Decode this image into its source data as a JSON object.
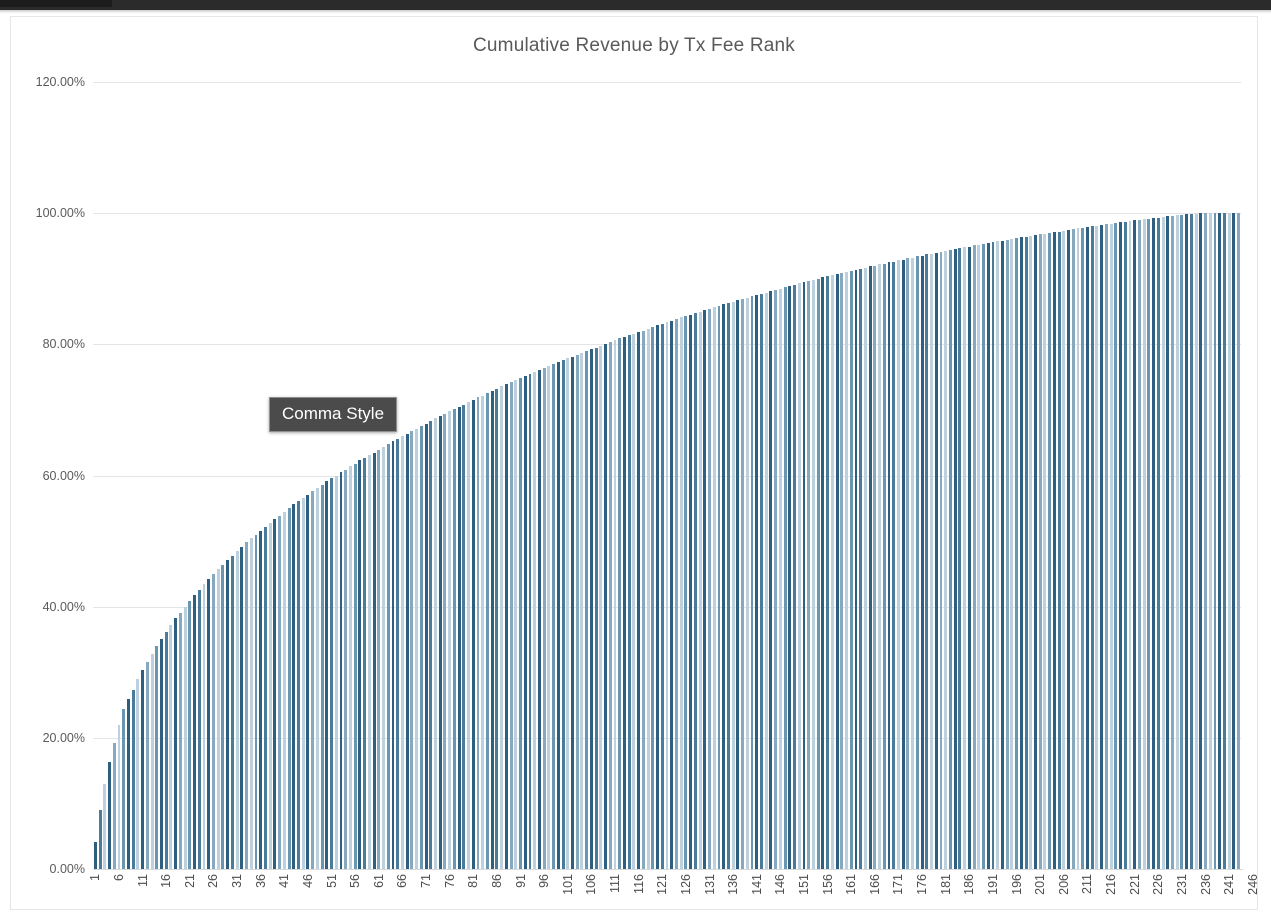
{
  "window": {
    "chrome_color": "#2b2b2b",
    "tab_color": "#1c1c1c"
  },
  "tooltip": {
    "label": "Comma Style",
    "background": "#4b4b4b",
    "text_color": "#ffffff"
  },
  "chart_data": {
    "type": "bar",
    "title": "Cumulative Revenue by Tx Fee Rank",
    "xlabel": "",
    "ylabel": "",
    "ylim": [
      0,
      120
    ],
    "y_unit": "%",
    "grid": true,
    "legend": "none",
    "bar_color": "#2e5f80",
    "bar_color_light": "#bcd0dd",
    "y_ticks": [
      0,
      20,
      40,
      60,
      80,
      100,
      120
    ],
    "y_tick_labels": [
      "0.00%",
      "20.00%",
      "40.00%",
      "60.00%",
      "80.00%",
      "100.00%",
      "120.00%"
    ],
    "x_tick_labels": [
      "1",
      "6",
      "11",
      "16",
      "21",
      "26",
      "31",
      "36",
      "41",
      "46",
      "51",
      "56",
      "61",
      "66",
      "71",
      "76",
      "81",
      "86",
      "91",
      "96",
      "101",
      "106",
      "111",
      "116",
      "121",
      "126",
      "131",
      "136",
      "141",
      "146",
      "151",
      "156",
      "161",
      "166",
      "171",
      "176",
      "181",
      "186",
      "191",
      "196",
      "201",
      "206",
      "211",
      "216",
      "221",
      "226",
      "231",
      "236",
      "241",
      "246"
    ],
    "x_tick_step": 5,
    "n_points": 250,
    "categories": [
      1,
      2,
      3,
      4,
      5,
      6,
      7,
      8,
      9,
      10,
      11,
      12,
      13,
      14,
      15,
      16,
      17,
      18,
      19,
      20,
      21,
      22,
      23,
      24,
      25,
      26,
      27,
      28,
      29,
      30,
      31,
      32,
      33,
      34,
      35,
      36,
      37,
      38,
      39,
      40,
      41,
      42,
      43,
      44,
      45,
      46,
      47,
      48,
      49,
      50,
      51,
      52,
      53,
      54,
      55,
      56,
      57,
      58,
      59,
      60,
      61,
      62,
      63,
      64,
      65,
      66,
      67,
      68,
      69,
      70,
      71,
      72,
      73,
      74,
      75,
      76,
      77,
      78,
      79,
      80,
      81,
      82,
      83,
      84,
      85,
      86,
      87,
      88,
      89,
      90,
      91,
      92,
      93,
      94,
      95,
      96,
      97,
      98,
      99,
      100,
      101,
      102,
      103,
      104,
      105,
      106,
      107,
      108,
      109,
      110,
      111,
      112,
      113,
      114,
      115,
      116,
      117,
      118,
      119,
      120,
      121,
      122,
      123,
      124,
      125,
      126,
      127,
      128,
      129,
      130,
      131,
      132,
      133,
      134,
      135,
      136,
      137,
      138,
      139,
      140,
      141,
      142,
      143,
      144,
      145,
      146,
      147,
      148,
      149,
      150,
      151,
      152,
      153,
      154,
      155,
      156,
      157,
      158,
      159,
      160,
      161,
      162,
      163,
      164,
      165,
      166,
      167,
      168,
      169,
      170,
      171,
      172,
      173,
      174,
      175,
      176,
      177,
      178,
      179,
      180,
      181,
      182,
      183,
      184,
      185,
      186,
      187,
      188,
      189,
      190,
      191,
      192,
      193,
      194,
      195,
      196,
      197,
      198,
      199,
      200,
      201,
      202,
      203,
      204,
      205,
      206,
      207,
      208,
      209,
      210,
      211,
      212,
      213,
      214,
      215,
      216,
      217,
      218,
      219,
      220,
      221,
      222,
      223,
      224,
      225,
      226,
      227,
      228,
      229,
      230,
      231,
      232,
      233,
      234,
      235,
      236,
      237,
      238,
      239,
      240,
      241,
      242,
      243,
      244,
      245,
      246,
      247,
      248,
      249,
      250
    ],
    "values": [
      4.1,
      9.0,
      13.0,
      16.3,
      19.2,
      21.9,
      24.4,
      25.9,
      27.3,
      29.0,
      30.3,
      31.6,
      32.8,
      34.0,
      35.1,
      36.2,
      37.2,
      38.2,
      39.1,
      40.0,
      40.9,
      41.8,
      42.6,
      43.4,
      44.2,
      45.0,
      45.7,
      46.4,
      47.1,
      47.8,
      48.5,
      49.1,
      49.8,
      50.4,
      51.0,
      51.6,
      52.2,
      52.8,
      53.4,
      53.9,
      54.5,
      55.0,
      55.6,
      56.1,
      56.6,
      57.1,
      57.6,
      58.1,
      58.6,
      59.1,
      59.6,
      60.0,
      60.5,
      60.9,
      61.4,
      61.8,
      62.3,
      62.7,
      63.1,
      63.5,
      63.9,
      64.4,
      64.8,
      65.2,
      65.6,
      66.0,
      66.4,
      66.8,
      67.1,
      67.5,
      67.9,
      68.3,
      68.7,
      69.0,
      69.4,
      69.8,
      70.1,
      70.5,
      70.8,
      71.2,
      71.5,
      71.9,
      72.2,
      72.6,
      72.9,
      73.2,
      73.6,
      73.9,
      74.2,
      74.5,
      74.8,
      75.2,
      75.5,
      75.8,
      76.1,
      76.4,
      76.7,
      77.0,
      77.3,
      77.6,
      77.9,
      78.1,
      78.4,
      78.7,
      79.0,
      79.3,
      79.5,
      79.8,
      80.1,
      80.3,
      80.6,
      80.9,
      81.1,
      81.4,
      81.6,
      81.9,
      82.1,
      82.4,
      82.6,
      82.9,
      83.1,
      83.4,
      83.6,
      83.8,
      84.1,
      84.3,
      84.5,
      84.8,
      85.0,
      85.2,
      85.4,
      85.7,
      85.9,
      86.1,
      86.3,
      86.5,
      86.7,
      86.9,
      87.1,
      87.3,
      87.5,
      87.7,
      87.9,
      88.1,
      88.3,
      88.5,
      88.7,
      88.9,
      89.1,
      89.3,
      89.5,
      89.6,
      89.8,
      90.0,
      90.2,
      90.4,
      90.5,
      90.7,
      90.9,
      91.0,
      91.2,
      91.4,
      91.5,
      91.7,
      91.9,
      92.0,
      92.2,
      92.3,
      92.5,
      92.6,
      92.8,
      92.9,
      93.1,
      93.2,
      93.4,
      93.5,
      93.7,
      93.8,
      94.0,
      94.1,
      94.2,
      94.4,
      94.5,
      94.7,
      94.8,
      94.9,
      95.1,
      95.2,
      95.3,
      95.4,
      95.6,
      95.7,
      95.8,
      95.9,
      96.1,
      96.2,
      96.3,
      96.4,
      96.5,
      96.7,
      96.8,
      96.9,
      97.0,
      97.1,
      97.2,
      97.3,
      97.4,
      97.6,
      97.7,
      97.8,
      97.9,
      98.0,
      98.1,
      98.2,
      98.3,
      98.4,
      98.5,
      98.6,
      98.7,
      98.8,
      98.9,
      99.0,
      99.1,
      99.1,
      99.2,
      99.3,
      99.4,
      99.5,
      99.6,
      99.7,
      99.7,
      99.8,
      99.9,
      99.9,
      100.0,
      100.0,
      100.0,
      100.0,
      100.0,
      100.0,
      100.0,
      100.0,
      100.0
    ]
  }
}
